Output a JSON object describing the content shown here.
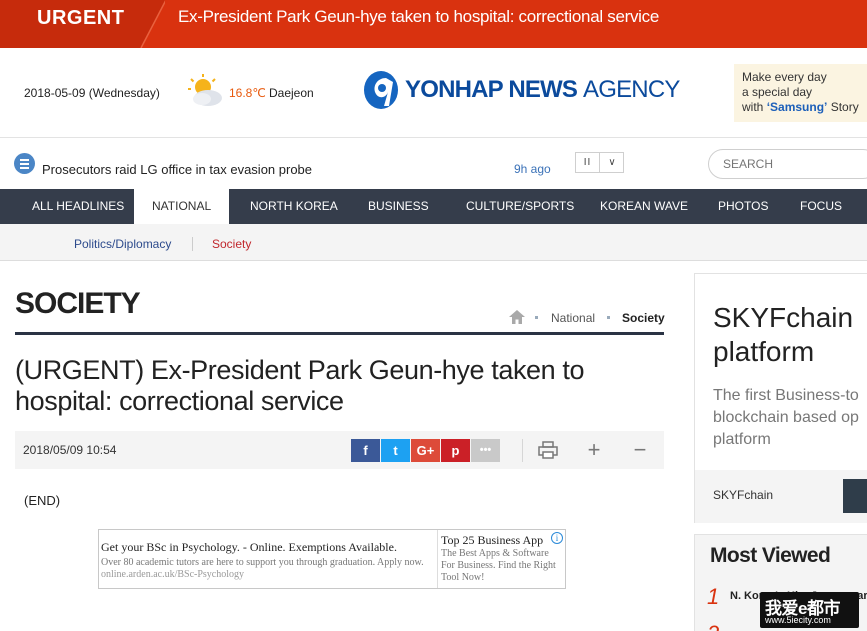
{
  "urgent": {
    "tag": "URGENT",
    "headline": "Ex-President Park Geun-hye taken to hospital: correctional service"
  },
  "header": {
    "date": "2018-05-09 (Wednesday)",
    "temperature": "16.8℃",
    "city": "Daejeon",
    "weather_icon": "partly-cloudy-icon",
    "logo_bold": "YONHAP NEWS",
    "logo_light": "AGENCY",
    "promo": {
      "line1": "Make every day",
      "line2": "a special day",
      "line3_prefix": "with",
      "brand": "‘Samsung’",
      "line3_suffix": "Story"
    }
  },
  "ticker": {
    "text": "Prosecutors raid LG office in tax evasion probe",
    "time_ago": "9h ago",
    "pause_label": "II",
    "down_label": "∨"
  },
  "search": {
    "placeholder": "SEARCH"
  },
  "nav": {
    "items": [
      "ALL HEADLINES",
      "NATIONAL",
      "NORTH KOREA",
      "BUSINESS",
      "CULTURE/SPORTS",
      "KOREAN WAVE",
      "PHOTOS",
      "FOCUS"
    ],
    "active": "NATIONAL"
  },
  "subnav": {
    "items": [
      "Politics/Diplomacy",
      "Society"
    ],
    "active": "Society"
  },
  "article": {
    "section": "SOCIETY",
    "breadcrumb": [
      "National",
      "Society"
    ],
    "title": "(URGENT) Ex-President Park Geun-hye taken to hospital: correctional service",
    "datetime": "2018/05/09 10:54",
    "body": "(END)"
  },
  "share": {
    "facebook": "f",
    "twitter": "t",
    "googleplus": "G+",
    "pinterest": "p",
    "more": "•••"
  },
  "tools": {
    "print": "🖶",
    "zoom_in": "+",
    "zoom_out": "−"
  },
  "ad": {
    "left_title": "Get your BSc in Psychology. - Online. Exemptions Available.",
    "left_desc": "Over 80 academic tutors are here to support you through graduation. Apply now.",
    "left_url": "online.arden.ac.uk/BSc-Psychology",
    "right_title": "Top 25 Business App",
    "right_desc": "The Best Apps & Software For Business. Find the Right Tool Now!",
    "info": "i"
  },
  "sidebar": {
    "card": {
      "title_line1": "SKYFchain",
      "title_line2": "platform",
      "desc_line1": "The first Business-to",
      "desc_line2": "blockchain based op",
      "desc_line3": "platform",
      "advertiser": "SKYFchain"
    },
    "most_viewed": {
      "title": "Most Viewed",
      "rank1": "1",
      "item1": "N. Korea's Kim Jong-un ar",
      "rank2": "2"
    }
  },
  "watermark": {
    "line1": "我爱e都市",
    "line2": "www.5iecity.com"
  },
  "colors": {
    "urgent_red": "#d9320f",
    "nav_bg": "#353d4b",
    "brand_blue": "#0b4a9c",
    "facebook": "#3b5998",
    "twitter": "#1da1f2",
    "googleplus": "#dd4b39",
    "pinterest": "#cb2027"
  }
}
